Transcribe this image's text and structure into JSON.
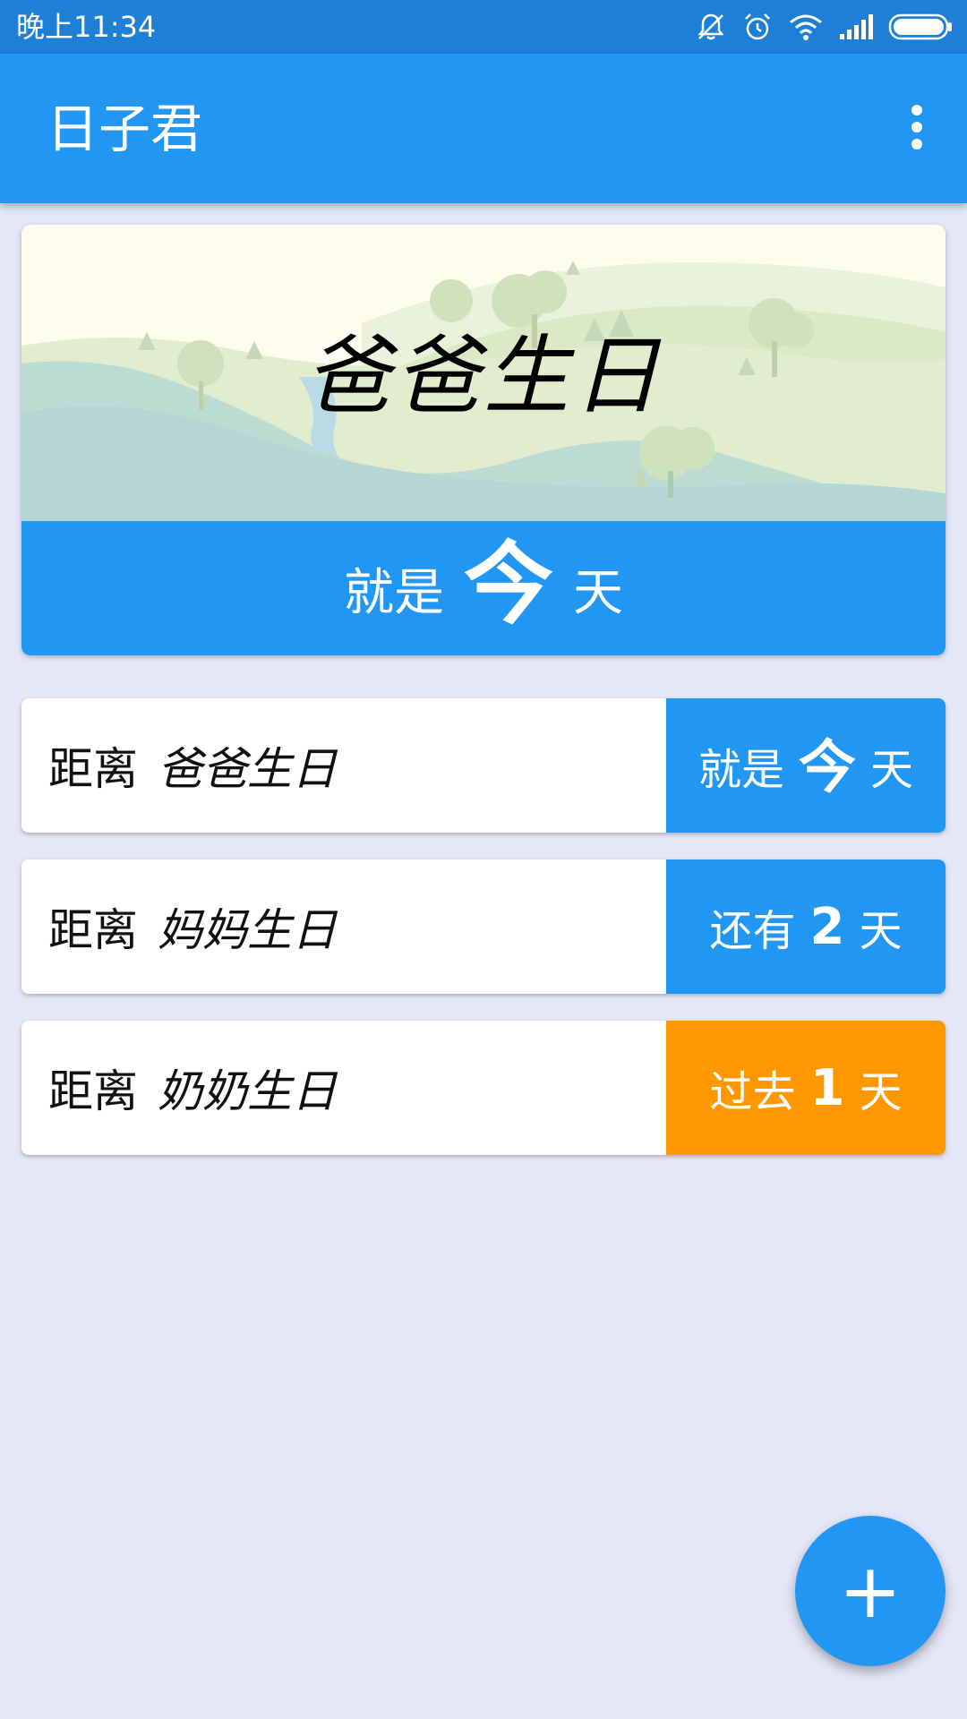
{
  "status_bar": {
    "time": "晚上11:34",
    "icons": [
      "mute-icon",
      "alarm-icon",
      "wifi-icon",
      "signal-icon",
      "battery-icon"
    ]
  },
  "app_bar": {
    "title": "日子君",
    "menu_icon": "more-vert-icon"
  },
  "hero": {
    "title": "爸爸生日",
    "prefix": "就是",
    "number": "今",
    "suffix": "天"
  },
  "events": [
    {
      "prefix": "距离",
      "name": "爸爸生日",
      "days_prefix": "就是",
      "days_number": "今",
      "days_suffix": "天",
      "color": "#2196f3"
    },
    {
      "prefix": "距离",
      "name": "妈妈生日",
      "days_prefix": "还有",
      "days_number": "2",
      "days_suffix": "天",
      "color": "#2196f3"
    },
    {
      "prefix": "距离",
      "name": "奶奶生日",
      "days_prefix": "过去",
      "days_number": "1",
      "days_suffix": "天",
      "color": "#ff9800"
    }
  ],
  "fab": {
    "label": "+"
  },
  "colors": {
    "primary": "#2196f3",
    "primary_dark": "#1e7fd6",
    "past": "#ff9800",
    "background": "#e5e6f8"
  }
}
